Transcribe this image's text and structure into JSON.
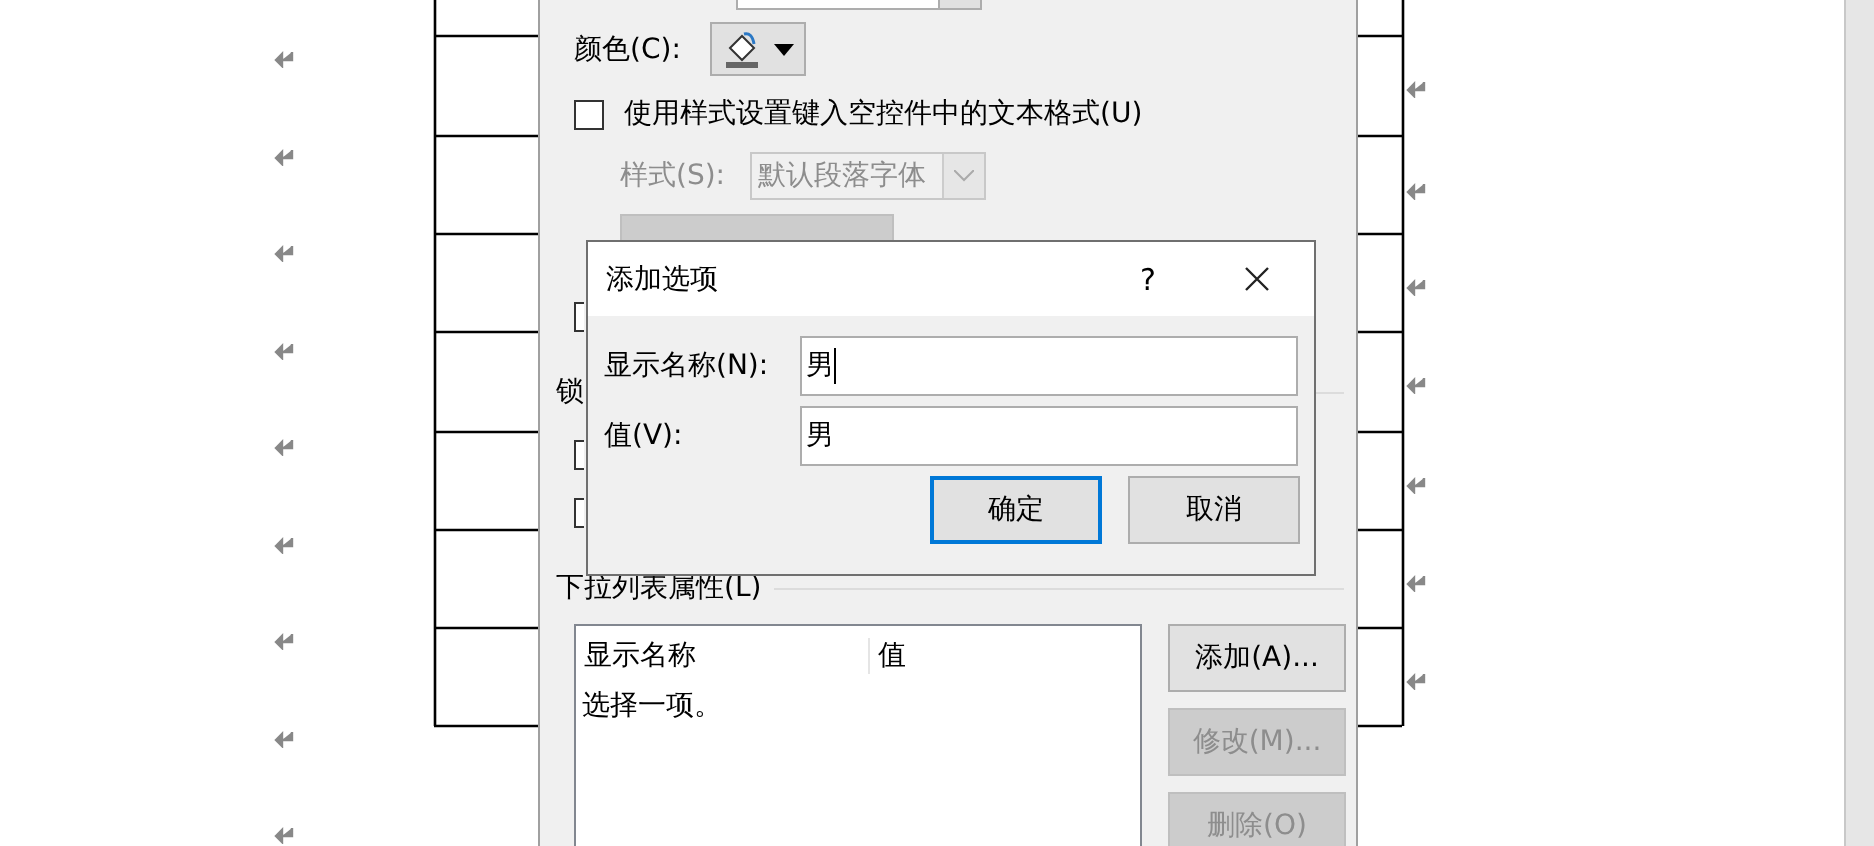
{
  "content_control_dialog": {
    "color_label": "颜色(C):",
    "style_checkbox": {
      "label": "使用样式设置键入空控件中的文本格式(U)",
      "checked": false
    },
    "style_label": "样式(S):",
    "style_value": "默认段落字体",
    "style_disabled": true,
    "new_style_button": {
      "disabled": true
    },
    "extra_control": {
      "kind": "checkbox",
      "checked": false
    },
    "locking_label": "锁",
    "locking_controls": [
      {
        "kind": "checkbox",
        "checked": false
      },
      {
        "kind": "checkbox",
        "checked": false
      }
    ],
    "dropdown_section_label": "下拉列表属性(L)",
    "list": {
      "columns": [
        "显示名称",
        "值"
      ],
      "rows": [
        {
          "display_name": "选择一项。"
        }
      ]
    },
    "buttons": [
      {
        "label": "添加(A)...",
        "disabled": false
      },
      {
        "label": "修改(M)...",
        "disabled": true
      },
      {
        "label": "删除(O)",
        "disabled": true
      }
    ]
  },
  "add_option_dialog": {
    "title": "添加选项",
    "help_button": "?",
    "fields": [
      {
        "label": "显示名称(N):",
        "value": "男",
        "focused": true
      },
      {
        "label": "值(V):",
        "value": "男",
        "focused": false
      }
    ],
    "buttons": [
      {
        "label": "确定",
        "default": true
      },
      {
        "label": "取消",
        "default": false
      }
    ]
  }
}
